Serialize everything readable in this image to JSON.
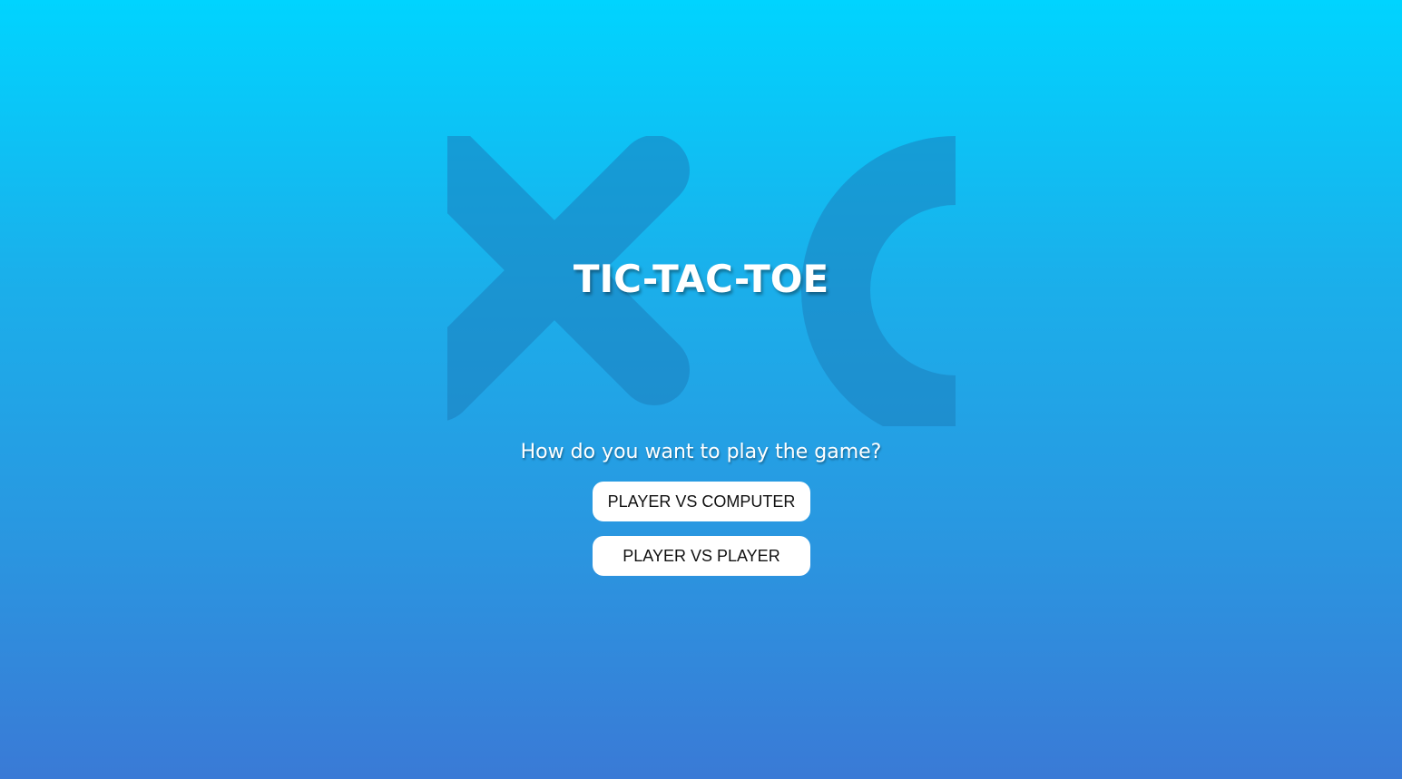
{
  "game": {
    "title": "TIC-TAC-TOE",
    "prompt": "How do you want to play the game?",
    "buttons": {
      "player_vs_computer": "PLAYER VS COMPUTER",
      "player_vs_player": "PLAYER VS PLAYER"
    },
    "logo_icons": [
      "x-mark-icon",
      "o-mark-icon"
    ]
  },
  "colors": {
    "background_top": "#00d4ff",
    "background_bottom": "#3a7ad6",
    "logo_mark": "#1e8fc8",
    "button_bg": "#ffffff",
    "text": "#ffffff"
  }
}
